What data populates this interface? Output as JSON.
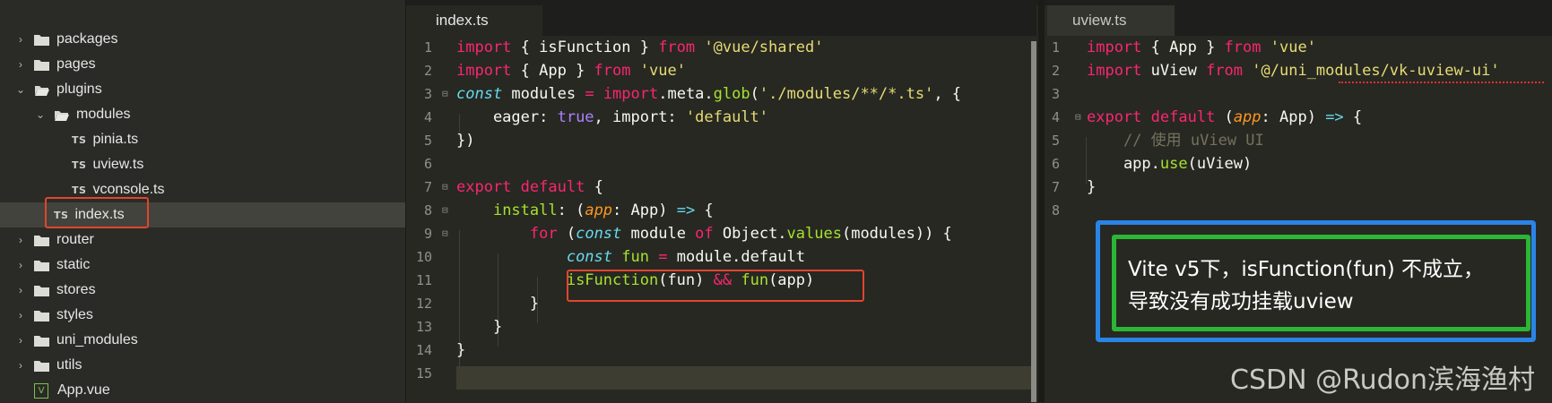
{
  "sidebar": {
    "items": [
      {
        "label": "packages",
        "kind": "folder",
        "state": "collapsed"
      },
      {
        "label": "pages",
        "kind": "folder",
        "state": "collapsed"
      },
      {
        "label": "plugins",
        "kind": "folder",
        "state": "expanded"
      },
      {
        "label": "modules",
        "kind": "folder",
        "state": "expanded"
      },
      {
        "label": "pinia.ts",
        "kind": "ts-file",
        "badge": "TS"
      },
      {
        "label": "uview.ts",
        "kind": "ts-file",
        "badge": "TS"
      },
      {
        "label": "vconsole.ts",
        "kind": "ts-file",
        "badge": "TS"
      },
      {
        "label": "index.ts",
        "kind": "ts-file",
        "badge": "TS",
        "selected": true
      },
      {
        "label": "router",
        "kind": "folder",
        "state": "collapsed"
      },
      {
        "label": "static",
        "kind": "folder",
        "state": "collapsed"
      },
      {
        "label": "stores",
        "kind": "folder",
        "state": "collapsed"
      },
      {
        "label": "styles",
        "kind": "folder",
        "state": "collapsed"
      },
      {
        "label": "uni_modules",
        "kind": "folder",
        "state": "collapsed"
      },
      {
        "label": "utils",
        "kind": "folder",
        "state": "collapsed"
      },
      {
        "label": "App.vue",
        "kind": "vue-file",
        "badge": "V"
      }
    ]
  },
  "editor_left": {
    "tab_label": "index.ts",
    "line_numbers": [
      "1",
      "2",
      "3",
      "4",
      "5",
      "6",
      "7",
      "8",
      "9",
      "10",
      "11",
      "12",
      "13",
      "14",
      "15"
    ]
  },
  "editor_right": {
    "tab_label": "uview.ts",
    "line_numbers": [
      "1",
      "2",
      "3",
      "4",
      "5",
      "6",
      "7",
      "8"
    ]
  },
  "annotation": {
    "line1": "Vite v5下，isFunction(fun) 不成立，",
    "line2": "导致没有成功挂载uview"
  },
  "watermark": "CSDN @Rudon滨海渔村",
  "colors": {
    "background": "#272822",
    "keyword": "#f92672",
    "storage": "#66d9ef",
    "function": "#a6e22e",
    "string": "#e6db74",
    "constant": "#ae81ff",
    "parameter": "#fd971f",
    "comment": "#75715e",
    "highlight_red": "#e2452d",
    "highlight_blue": "#2a84e6",
    "highlight_green": "#2bb636"
  }
}
